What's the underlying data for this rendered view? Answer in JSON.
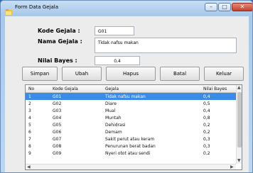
{
  "window": {
    "title": "Form Data Gejala",
    "minimize": "–",
    "maximize": "□",
    "close": "✕"
  },
  "form": {
    "kode_label": "Kode Gejala :",
    "kode_value": "G01",
    "nama_label": "Nama Gejala :",
    "nama_value": "Tidak nafsu makan",
    "nilai_label": "Nilai Bayes :",
    "nilai_value": "0,4"
  },
  "buttons": {
    "simpan": "Simpan",
    "ubah": "Ubah",
    "hapus": "Hapus",
    "batal": "Batal",
    "keluar": "Keluar"
  },
  "table": {
    "columns": [
      "No",
      "Kode Gejala",
      "Gejala",
      "Nilai Bayes"
    ],
    "rows": [
      [
        "1",
        "G01",
        "Tidak nafsu makan",
        "0,4"
      ],
      [
        "2",
        "G02",
        "Diare",
        "0,5"
      ],
      [
        "3",
        "G03",
        "Mual",
        "0,4"
      ],
      [
        "4",
        "G04",
        "Muntah",
        "0,8"
      ],
      [
        "5",
        "G05",
        "Dehidrasi",
        "0,2"
      ],
      [
        "6",
        "G06",
        "Demam",
        "0,2"
      ],
      [
        "7",
        "G07",
        "Sakit perut atau keram",
        "0,3"
      ],
      [
        "8",
        "G08",
        "Penurunan berat badan",
        "0,3"
      ],
      [
        "9",
        "G09",
        "Nyeri otot atau sendi",
        "0,2"
      ]
    ],
    "selected_row": 0
  },
  "colors": {
    "selection": "#3a8ce6",
    "close_button": "#c2422c"
  }
}
